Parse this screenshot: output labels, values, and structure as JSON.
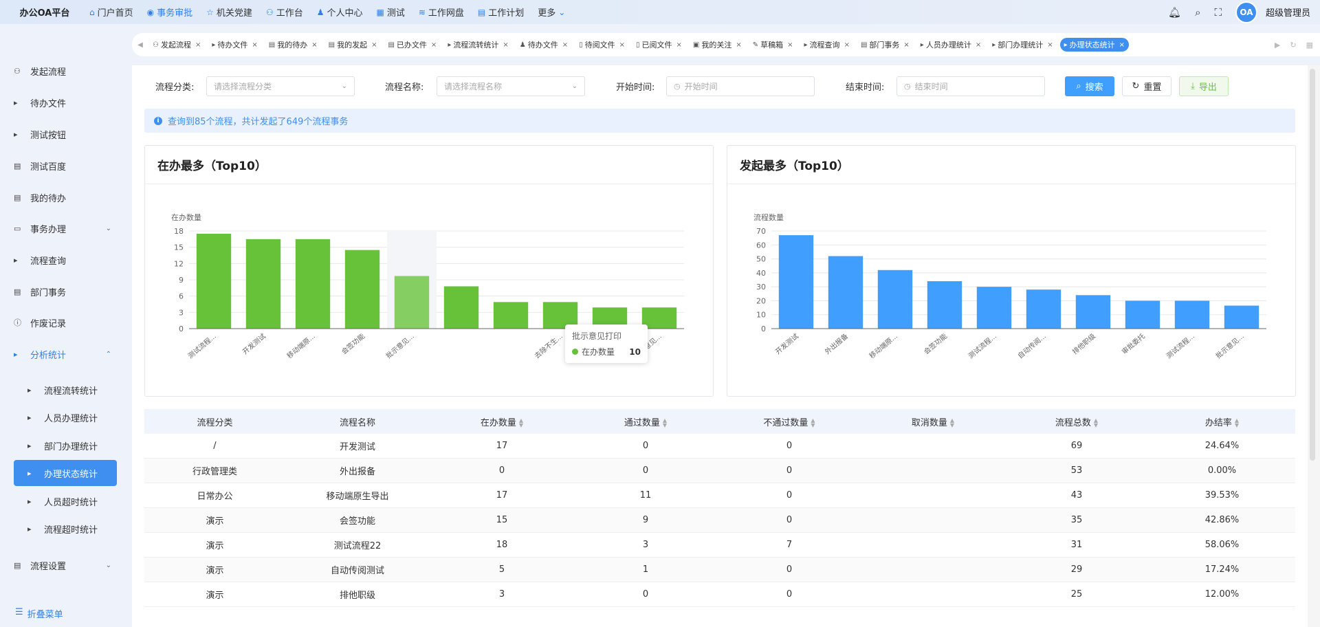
{
  "app": {
    "title": "办公OA平台",
    "user": "超级管理员",
    "avatar_text": "OA"
  },
  "nav": [
    {
      "label": "门户首页",
      "icon": "home-icon",
      "glyph": "⌂"
    },
    {
      "label": "事务审批",
      "icon": "approval-icon",
      "glyph": "◉",
      "active": true
    },
    {
      "label": "机关党建",
      "icon": "star-icon",
      "glyph": "☆"
    },
    {
      "label": "工作台",
      "icon": "workbench-icon",
      "glyph": "⚇"
    },
    {
      "label": "个人中心",
      "icon": "user-icon",
      "glyph": "♟"
    },
    {
      "label": "测试",
      "icon": "grid-icon",
      "glyph": "▦"
    },
    {
      "label": "工作网盘",
      "icon": "disk-icon",
      "glyph": "≋"
    },
    {
      "label": "工作计划",
      "icon": "calendar-icon",
      "glyph": "▤"
    },
    {
      "label": "更多",
      "icon": "chevron-down-icon",
      "glyph": "⌄"
    }
  ],
  "sidebar": [
    {
      "label": "发起流程",
      "icon": "flow-icon",
      "glyph": "⚇",
      "y": 68
    },
    {
      "label": "待办文件",
      "icon": "caret-icon",
      "glyph": "▸",
      "y": 114
    },
    {
      "label": "测试按钮",
      "icon": "caret-icon",
      "glyph": "▸",
      "y": 160
    },
    {
      "label": "测试百度",
      "icon": "doc-icon",
      "glyph": "▤",
      "y": 206
    },
    {
      "label": "我的待办",
      "icon": "doc-icon",
      "glyph": "▤",
      "y": 252
    },
    {
      "label": "事务办理",
      "icon": "folder-icon",
      "glyph": "▭",
      "y": 297,
      "arrow": "⌄"
    },
    {
      "label": "流程查询",
      "icon": "caret-icon",
      "glyph": "▸",
      "y": 343
    },
    {
      "label": "部门事务",
      "icon": "doc-icon",
      "glyph": "▤",
      "y": 389
    },
    {
      "label": "作废记录",
      "icon": "info-icon",
      "glyph": "ⓘ",
      "y": 434
    },
    {
      "label": "分析统计",
      "icon": "caret-icon",
      "glyph": "▸",
      "y": 480,
      "arrow": "⌃",
      "blue": true
    },
    {
      "label": "流程流转统计",
      "icon": "caret-icon",
      "glyph": "▸",
      "y": 532,
      "sub": true
    },
    {
      "label": "人员办理统计",
      "icon": "caret-icon",
      "glyph": "▸",
      "y": 572,
      "sub": true
    },
    {
      "label": "部门办理统计",
      "icon": "caret-icon",
      "glyph": "▸",
      "y": 613,
      "sub": true
    },
    {
      "label": "办理状态统计",
      "icon": "caret-icon",
      "glyph": "▸",
      "y": 653,
      "sub": true,
      "active": true
    },
    {
      "label": "人员超时统计",
      "icon": "caret-icon",
      "glyph": "▸",
      "y": 694,
      "sub": true
    },
    {
      "label": "流程超时统计",
      "icon": "caret-icon",
      "glyph": "▸",
      "y": 734,
      "sub": true
    },
    {
      "label": "流程设置",
      "icon": "doc-icon",
      "glyph": "▤",
      "y": 787,
      "arrow": "⌄"
    }
  ],
  "collapse_label": "折叠菜单",
  "tabs": [
    {
      "label": "发起流程",
      "glyph": "⚇"
    },
    {
      "label": "待办文件",
      "glyph": "▸"
    },
    {
      "label": "我的待办",
      "glyph": "▤"
    },
    {
      "label": "我的发起",
      "glyph": "▤"
    },
    {
      "label": "已办文件",
      "glyph": "▤"
    },
    {
      "label": "流程流转统计",
      "glyph": "▸"
    },
    {
      "label": "待办文件",
      "glyph": "♟"
    },
    {
      "label": "待阅文件",
      "glyph": "▯"
    },
    {
      "label": "已阅文件",
      "glyph": "▯"
    },
    {
      "label": "我的关注",
      "glyph": "▣"
    },
    {
      "label": "草稿箱",
      "glyph": "✎"
    },
    {
      "label": "流程查询",
      "glyph": "▸"
    },
    {
      "label": "部门事务",
      "glyph": "▤"
    },
    {
      "label": "人员办理统计",
      "glyph": "▸"
    },
    {
      "label": "部门办理统计",
      "glyph": "▸"
    },
    {
      "label": "办理状态统计",
      "glyph": "▸",
      "active": true
    }
  ],
  "filter": {
    "category_label": "流程分类:",
    "category_placeholder": "请选择流程分类",
    "name_label": "流程名称:",
    "name_placeholder": "请选择流程名称",
    "start_label": "开始时间:",
    "start_placeholder": "开始时间",
    "end_label": "结束时间:",
    "end_placeholder": "结束时间",
    "search": "搜索",
    "reset": "重置",
    "export": "导出"
  },
  "info": "查询到85个流程，共计发起了649个流程事务",
  "tooltip": {
    "title": "批示意见打印",
    "series": "在办数量",
    "value": "10"
  },
  "chart_data": [
    {
      "type": "bar",
      "title": "在办最多（Top10）",
      "ylabel": "在办数量",
      "color": "#67c23a",
      "ylim": [
        0,
        18
      ],
      "yticks": [
        0,
        3,
        6,
        9,
        12,
        15,
        18
      ],
      "categories": [
        "测试流程...",
        "开发测试",
        "移动端原...",
        "会签功能",
        "批示意见...",
        "",
        "去除不生...",
        "测试流程...",
        "审批意见..."
      ],
      "values": [
        17.5,
        16.5,
        16.5,
        14.5,
        9.7,
        7.8,
        4.9,
        4.9,
        3.9,
        3.9
      ],
      "highlight": 4
    },
    {
      "type": "bar",
      "title": "发起最多（Top10）",
      "ylabel": "流程数量",
      "color": "#409eff",
      "ylim": [
        0,
        70
      ],
      "yticks": [
        0,
        10,
        20,
        30,
        40,
        50,
        60,
        70
      ],
      "categories": [
        "开发测试",
        "外出报备",
        "移动端原...",
        "会签功能",
        "测试流程...",
        "自动传阅...",
        "排他职级",
        "审批委托",
        "测试流程...",
        "批示意见..."
      ],
      "values": [
        67,
        52,
        42,
        34,
        30,
        28,
        24,
        20,
        20,
        16.5
      ]
    }
  ],
  "table": {
    "columns": [
      {
        "label": "流程分类",
        "w": 205
      },
      {
        "label": "流程名称",
        "w": 210,
        "sort": false
      },
      {
        "label": "在办数量",
        "w": 210,
        "sort": true
      },
      {
        "label": "通过数量",
        "w": 208,
        "sort": true
      },
      {
        "label": "不通过数量",
        "w": 210,
        "sort": true
      },
      {
        "label": "取消数量",
        "w": 208,
        "sort": true
      },
      {
        "label": "流程总数",
        "w": 210,
        "sort": true
      },
      {
        "label": "办结率",
        "w": 213,
        "sort": true
      }
    ],
    "rows": [
      [
        "/",
        "开发测试",
        "17",
        "0",
        "0",
        "",
        "69",
        "24.64%"
      ],
      [
        "行政管理类",
        "外出报备",
        "0",
        "0",
        "0",
        "",
        "53",
        "0.00%"
      ],
      [
        "日常办公",
        "移动端原生导出",
        "17",
        "11",
        "0",
        "",
        "43",
        "39.53%"
      ],
      [
        "演示",
        "会签功能",
        "15",
        "9",
        "0",
        "",
        "35",
        "42.86%"
      ],
      [
        "演示",
        "测试流程22",
        "18",
        "3",
        "7",
        "",
        "31",
        "58.06%"
      ],
      [
        "演示",
        "自动传阅测试",
        "5",
        "1",
        "0",
        "",
        "29",
        "17.24%"
      ],
      [
        "演示",
        "排他职级",
        "3",
        "0",
        "0",
        "",
        "25",
        "12.00%"
      ]
    ]
  }
}
